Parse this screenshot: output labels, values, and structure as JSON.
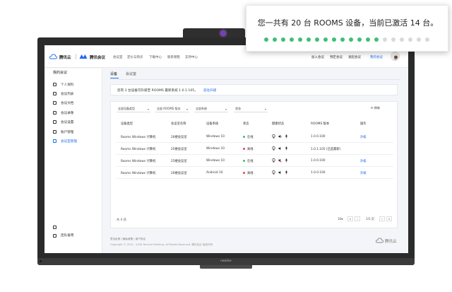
{
  "callout": {
    "text": "您一共有 20 台 ROOMS 设备，当前已激活 14 台。",
    "total": 20,
    "active": 14,
    "active_color": "#3dbf76",
    "inactive_color": "#d9d9d9"
  },
  "monitor": {
    "brand": "newline"
  },
  "topbar": {
    "logo_text": "腾讯云",
    "product": "腾讯会议",
    "nav": [
      "会议室",
      "定价与购买",
      "下载中心",
      "联系销售",
      "支持中心"
    ],
    "right_nav": [
      "加入会议",
      "预定会议",
      "发起会议",
      "我的会议"
    ]
  },
  "sidebar": {
    "title": "我的会议",
    "items": [
      {
        "label": "个人资料",
        "icon": "user-icon"
      },
      {
        "label": "会议列表",
        "icon": "list-icon"
      },
      {
        "label": "会议文档",
        "icon": "document-icon"
      },
      {
        "label": "会议录像",
        "icon": "video-icon"
      },
      {
        "label": "会议设置",
        "icon": "settings-icon"
      },
      {
        "label": "账户管理",
        "icon": "account-icon"
      },
      {
        "label": "会议室管理",
        "icon": "room-icon"
      }
    ],
    "bottom": [
      {
        "label": "",
        "icon": "stamp-icon"
      },
      {
        "label": "团队备用",
        "icon": "team-icon"
      }
    ]
  },
  "main": {
    "tabs": [
      "设备",
      "会议室"
    ],
    "notice": "您有 3 台设备可升级至 ROOMS 最新系统 1.0.1.105，",
    "notice_link": "前往升级",
    "filters": [
      "全部设备类型",
      "全部 ROOMS 版本",
      "全部系统",
      "状态"
    ],
    "refresh": "刷新",
    "headers": [
      "设备类型",
      "会议室名称",
      "设备系统",
      "状态",
      "健康状态",
      "ROOMS 版本",
      "操作"
    ],
    "rows": [
      {
        "type": "Rooms Windows 计算机",
        "room": "26楼会议室",
        "os": "Windows 10",
        "status": "在线",
        "online": true,
        "version": "1.0.0.100",
        "action": "升级"
      },
      {
        "type": "Rooms Windows 计算机",
        "room": "25楼会议室",
        "os": "Windows 10",
        "status": "离线",
        "online": false,
        "version": "1.0.1.105 (已是最新)",
        "action": ""
      },
      {
        "type": "Rooms Windows 计算机",
        "room": "25楼会议室",
        "os": "Windows 10",
        "status": "在线",
        "online": true,
        "version": "1.0.0.100",
        "action": "升级"
      },
      {
        "type": "Rooms Windows 计算机",
        "room": "26楼会议室",
        "os": "Android 10",
        "status": "离线",
        "online": false,
        "version": "1.0.0.100",
        "action": "升级"
      }
    ],
    "total": "共 4 项",
    "page_size": "10",
    "page": "1",
    "page_total": "/1 页"
  },
  "footer": {
    "links": "意见反馈 | 隐私政策 | 用户协议",
    "copyright": "Copyright © 2013 - 2018 Tencent Meeting. All Rights Reserved. 腾讯会议 版权所有",
    "logo": "腾讯云"
  },
  "colors": {
    "accent": "#1a6cf0",
    "online": "#3dbf76",
    "offline": "#e5484d"
  }
}
